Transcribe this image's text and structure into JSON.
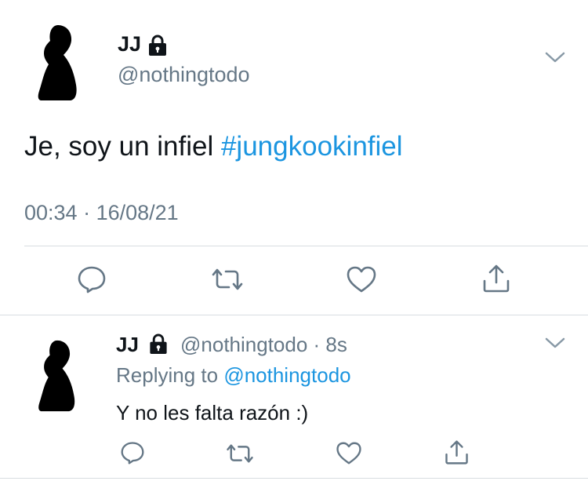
{
  "main_tweet": {
    "display_name": "JJ",
    "handle": "@nothingtodo",
    "text": "Je, soy un infiel ",
    "hashtag": "#jungkookinfiel",
    "time": "00:34",
    "separator": " · ",
    "date": "16/08/21",
    "icons": {
      "avatar": "user-silhouette",
      "lock": "lock-icon",
      "menu": "chevron-down-icon",
      "reply": "reply-icon",
      "retweet": "retweet-icon",
      "like": "heart-icon",
      "share": "share-icon"
    }
  },
  "reply_tweet": {
    "display_name": "JJ",
    "handle": "@nothingtodo",
    "dot": " · ",
    "age": "8s",
    "replying_prefix": "Replying to ",
    "replying_to": "@nothingtodo",
    "text": "Y no les falta razón :)"
  },
  "colors": {
    "text": "#0f1419",
    "secondary": "#657786",
    "link": "#1b95e0",
    "divider": "#d8dde1"
  }
}
